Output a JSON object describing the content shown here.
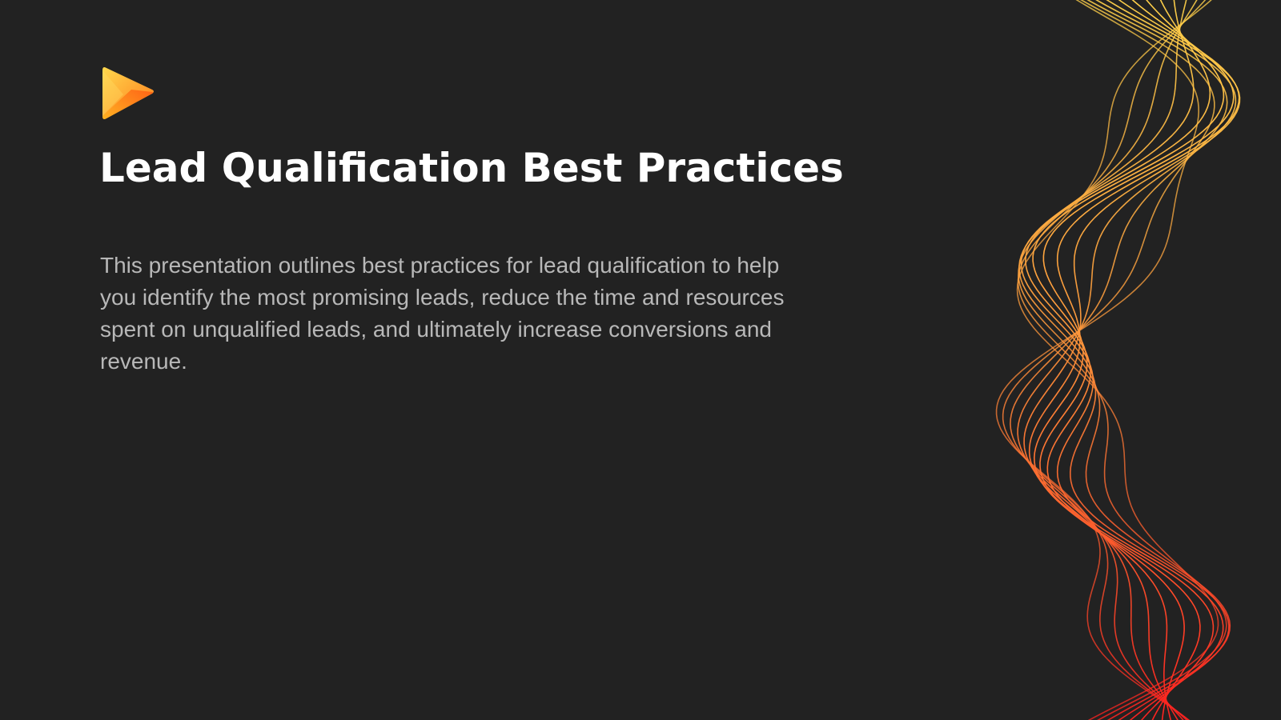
{
  "slide": {
    "logo_icon": "play-triangle-icon",
    "title": "Lead Qualification Best Practices",
    "body": "This presentation outlines best practices for lead qualification to help you identify the most promising leads, reduce the time and resources spent on unqualified leads, and ultimately increase conversions and revenue."
  },
  "colors": {
    "background": "#222222",
    "title": "#ffffff",
    "body": "#b8b8b8",
    "accent_yellow": "#ffd24a",
    "accent_orange": "#ff9a3c",
    "accent_red": "#ff2a1f"
  },
  "decoration": {
    "name": "gradient-wave-lines",
    "line_count": 14
  }
}
